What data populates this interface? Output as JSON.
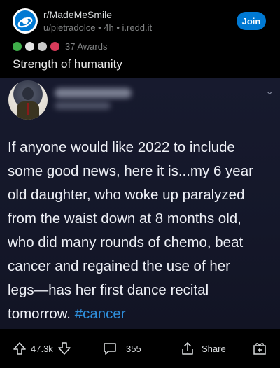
{
  "post": {
    "subreddit": "r/MadeMeSmile",
    "author": "u/pietradolce",
    "age": "4h",
    "domain": "i.redd.it",
    "join_label": "Join",
    "awards_label": "37 Awards",
    "title": "Strength of humanity"
  },
  "tweet": {
    "lines": [
      "If anyone would like 2022 to include",
      "some good news, here it is...my 6 year",
      "old daughter, who woke up paralyzed",
      "from the waist down at 8 months old,",
      "who did many rounds of chemo, beat",
      "cancer and regained the use of her",
      "legs—has her first dance recital"
    ],
    "last_line_text": "tomorrow. ",
    "hashtag": "#cancer"
  },
  "actions": {
    "votes": "47.3k",
    "comments": "355",
    "share_label": "Share"
  },
  "colors": {
    "accent": "#0079d3",
    "hashtag": "#2f8fdc",
    "background": "#000000"
  },
  "icons": [
    "reddit-logo-icon",
    "upvote-icon",
    "downvote-icon",
    "comment-icon",
    "share-icon",
    "award-add-icon",
    "chevron-down-icon"
  ]
}
